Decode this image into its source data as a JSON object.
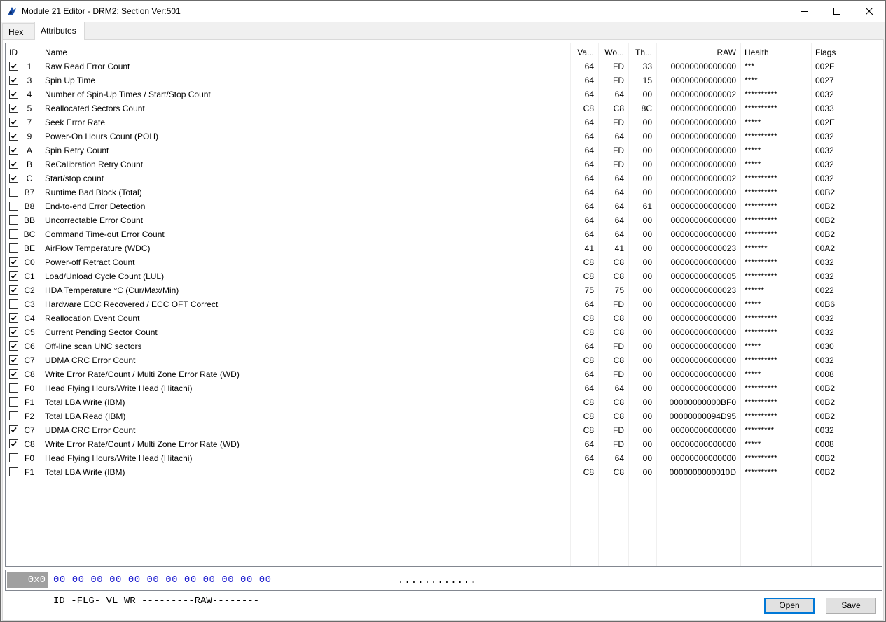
{
  "window": {
    "title": "Module 21 Editor - DRM2: Section Ver:501"
  },
  "tabs": [
    {
      "label": "Hex"
    },
    {
      "label": "Attributes"
    }
  ],
  "columns": {
    "id": "ID",
    "name": "Name",
    "va": "Va...",
    "wo": "Wo...",
    "th": "Th...",
    "raw": "RAW",
    "health": "Health",
    "flags": "Flags"
  },
  "rows": [
    {
      "checked": true,
      "id": "1",
      "name": "Raw Read Error Count",
      "va": "64",
      "wo": "FD",
      "th": "33",
      "raw": "00000000000000",
      "health": "***",
      "flags": "002F"
    },
    {
      "checked": true,
      "id": "3",
      "name": "Spin Up Time",
      "va": "64",
      "wo": "FD",
      "th": "15",
      "raw": "00000000000000",
      "health": "****",
      "flags": "0027"
    },
    {
      "checked": true,
      "id": "4",
      "name": "Number of Spin-Up Times / Start/Stop Count",
      "va": "64",
      "wo": "64",
      "th": "00",
      "raw": "00000000000002",
      "health": "**********",
      "flags": "0032"
    },
    {
      "checked": true,
      "id": "5",
      "name": "Reallocated Sectors Count",
      "va": "C8",
      "wo": "C8",
      "th": "8C",
      "raw": "00000000000000",
      "health": "**********",
      "flags": "0033"
    },
    {
      "checked": true,
      "id": "7",
      "name": "Seek Error Rate",
      "va": "64",
      "wo": "FD",
      "th": "00",
      "raw": "00000000000000",
      "health": "*****",
      "flags": "002E"
    },
    {
      "checked": true,
      "id": "9",
      "name": "Power-On Hours Count (POH)",
      "va": "64",
      "wo": "64",
      "th": "00",
      "raw": "00000000000000",
      "health": "**********",
      "flags": "0032"
    },
    {
      "checked": true,
      "id": "A",
      "name": "Spin Retry Count",
      "va": "64",
      "wo": "FD",
      "th": "00",
      "raw": "00000000000000",
      "health": "*****",
      "flags": "0032"
    },
    {
      "checked": true,
      "id": "B",
      "name": "ReCalibration Retry Count",
      "va": "64",
      "wo": "FD",
      "th": "00",
      "raw": "00000000000000",
      "health": "*****",
      "flags": "0032"
    },
    {
      "checked": true,
      "id": "C",
      "name": "Start/stop count",
      "va": "64",
      "wo": "64",
      "th": "00",
      "raw": "00000000000002",
      "health": "**********",
      "flags": "0032"
    },
    {
      "checked": false,
      "id": "B7",
      "name": "Runtime Bad Block (Total)",
      "va": "64",
      "wo": "64",
      "th": "00",
      "raw": "00000000000000",
      "health": "**********",
      "flags": "00B2"
    },
    {
      "checked": false,
      "id": "B8",
      "name": "End-to-end Error Detection",
      "va": "64",
      "wo": "64",
      "th": "61",
      "raw": "00000000000000",
      "health": "**********",
      "flags": "00B2"
    },
    {
      "checked": false,
      "id": "BB",
      "name": "Uncorrectable Error Count",
      "va": "64",
      "wo": "64",
      "th": "00",
      "raw": "00000000000000",
      "health": "**********",
      "flags": "00B2"
    },
    {
      "checked": false,
      "id": "BC",
      "name": "Command Time-out Error Count",
      "va": "64",
      "wo": "64",
      "th": "00",
      "raw": "00000000000000",
      "health": "**********",
      "flags": "00B2"
    },
    {
      "checked": false,
      "id": "BE",
      "name": "AirFlow Temperature (WDC)",
      "va": "41",
      "wo": "41",
      "th": "00",
      "raw": "00000000000023",
      "health": "*******",
      "flags": "00A2"
    },
    {
      "checked": true,
      "id": "C0",
      "name": "Power-off Retract Count",
      "va": "C8",
      "wo": "C8",
      "th": "00",
      "raw": "00000000000000",
      "health": "**********",
      "flags": "0032"
    },
    {
      "checked": true,
      "id": "C1",
      "name": "Load/Unload Cycle Count (LUL)",
      "va": "C8",
      "wo": "C8",
      "th": "00",
      "raw": "00000000000005",
      "health": "**********",
      "flags": "0032"
    },
    {
      "checked": true,
      "id": "C2",
      "name": "HDA Temperature °C (Cur/Max/Min)",
      "va": "75",
      "wo": "75",
      "th": "00",
      "raw": "00000000000023",
      "health": "******",
      "flags": "0022"
    },
    {
      "checked": false,
      "id": "C3",
      "name": "Hardware ECC Recovered / ECC OFT Correct",
      "va": "64",
      "wo": "FD",
      "th": "00",
      "raw": "00000000000000",
      "health": "*****",
      "flags": "00B6"
    },
    {
      "checked": true,
      "id": "C4",
      "name": "Reallocation Event Count",
      "va": "C8",
      "wo": "C8",
      "th": "00",
      "raw": "00000000000000",
      "health": "**********",
      "flags": "0032"
    },
    {
      "checked": true,
      "id": "C5",
      "name": "Current Pending Sector Count",
      "va": "C8",
      "wo": "C8",
      "th": "00",
      "raw": "00000000000000",
      "health": "**********",
      "flags": "0032"
    },
    {
      "checked": true,
      "id": "C6",
      "name": "Off-line scan UNC sectors",
      "va": "64",
      "wo": "FD",
      "th": "00",
      "raw": "00000000000000",
      "health": "*****",
      "flags": "0030"
    },
    {
      "checked": true,
      "id": "C7",
      "name": "UDMA CRC Error Count",
      "va": "C8",
      "wo": "C8",
      "th": "00",
      "raw": "00000000000000",
      "health": "**********",
      "flags": "0032"
    },
    {
      "checked": true,
      "id": "C8",
      "name": "Write Error Rate/Count / Multi Zone Error Rate (WD)",
      "va": "64",
      "wo": "FD",
      "th": "00",
      "raw": "00000000000000",
      "health": "*****",
      "flags": "0008"
    },
    {
      "checked": false,
      "id": "F0",
      "name": "Head Flying Hours/Write Head (Hitachi)",
      "va": "64",
      "wo": "64",
      "th": "00",
      "raw": "00000000000000",
      "health": "**********",
      "flags": "00B2"
    },
    {
      "checked": false,
      "id": "F1",
      "name": "Total LBA Write (IBM)",
      "va": "C8",
      "wo": "C8",
      "th": "00",
      "raw": "00000000000BF0",
      "health": "**********",
      "flags": "00B2"
    },
    {
      "checked": false,
      "id": "F2",
      "name": "Total LBA Read (IBM)",
      "va": "C8",
      "wo": "C8",
      "th": "00",
      "raw": "00000000094D95",
      "health": "**********",
      "flags": "00B2"
    },
    {
      "checked": true,
      "id": "C7",
      "name": "UDMA CRC Error Count",
      "va": "C8",
      "wo": "FD",
      "th": "00",
      "raw": "00000000000000",
      "health": "*********",
      "flags": "0032"
    },
    {
      "checked": true,
      "id": "C8",
      "name": "Write Error Rate/Count / Multi Zone Error Rate (WD)",
      "va": "64",
      "wo": "FD",
      "th": "00",
      "raw": "00000000000000",
      "health": "*****",
      "flags": "0008"
    },
    {
      "checked": false,
      "id": "F0",
      "name": "Head Flying Hours/Write Head (Hitachi)",
      "va": "64",
      "wo": "64",
      "th": "00",
      "raw": "00000000000000",
      "health": "**********",
      "flags": "00B2"
    },
    {
      "checked": false,
      "id": "F1",
      "name": "Total LBA Write (IBM)",
      "va": "C8",
      "wo": "C8",
      "th": "00",
      "raw": "0000000000010D",
      "health": "**********",
      "flags": "00B2"
    }
  ],
  "hex": {
    "offset": "0x0",
    "bytes": "00 00 00 00 00 00 00 00 00 00 00 00",
    "ascii": "............"
  },
  "legend": "ID -FLG- VL WR ---------RAW--------",
  "buttons": {
    "open": "Open",
    "save": "Save"
  }
}
